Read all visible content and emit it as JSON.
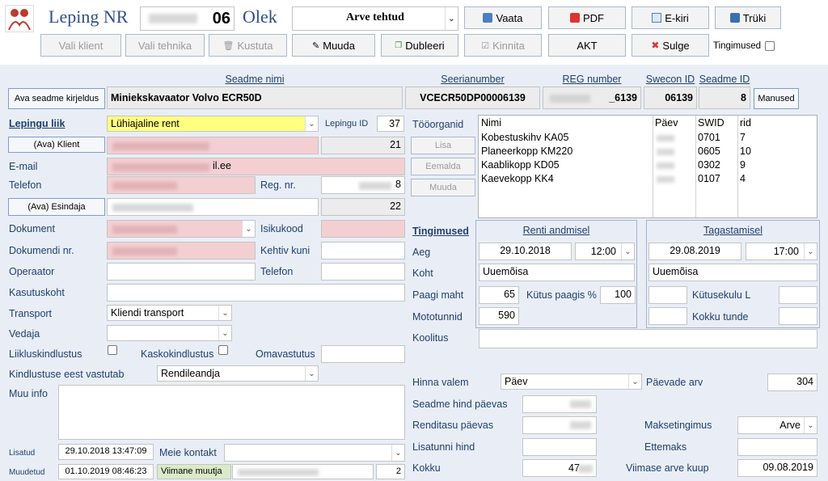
{
  "header": {
    "title": "Leping NR",
    "number": "06",
    "status_label": "Olek",
    "status_value": "Arve tehtud"
  },
  "toolbar": {
    "vaata": "Vaata",
    "pdf": "PDF",
    "ekiri": "E-kiri",
    "truki": "Trüki",
    "vali_klient": "Vali klient",
    "vali_tehnika": "Vali tehnika",
    "kustuta": "Kustuta",
    "muuda": "Muuda",
    "dubleeri": "Dubleeri",
    "kinnita": "Kinnita",
    "akt": "AKT",
    "sulge": "Sulge",
    "tingimused": "Tingimused"
  },
  "device": {
    "open_desc_button": "Ava seadme kirjeldus",
    "name_label": "Seadme nimi",
    "name": "Miniekskavaator Volvo ECR50D",
    "serial_label": "Seerianumber",
    "serial": "VCECR50DP00006139",
    "reg_label": "REG number",
    "reg": "_6139",
    "swecon_label": "Swecon ID",
    "swecon": "06139",
    "seadme_id_label": "Seadme ID",
    "seadme_id": "8",
    "attachments_button": "Manused"
  },
  "contract": {
    "type_label": "Lepingu liik",
    "type_value": "Lühiajaline rent",
    "id_label": "Lepingu ID",
    "id_value": "37",
    "client_button": "(Ava) Klient",
    "client_number": "21",
    "email_label": "E-mail",
    "email_value": "il.ee",
    "phone_label": "Telefon",
    "regnr_label": "Reg. nr.",
    "regnr_value": "8",
    "rep_button": "(Ava) Esindaja",
    "rep_number": "22",
    "doc_label": "Dokument",
    "idcode_label": "Isikukood",
    "docnr_label": "Dokumendi nr.",
    "valid_label": "Kehtiv kuni",
    "operator_label": "Operaator",
    "operator_phone_label": "Telefon",
    "site_label": "Kasutuskoht",
    "transport_label": "Transport",
    "transport_value": "Kliendi transport",
    "carrier_label": "Vedaja",
    "traffic_ins_label": "Liikluskindlustus",
    "casco_ins_label": "Kaskokindlustus",
    "deductible_label": "Omavastutus",
    "ins_resp_label": "Kindlustuse eest vastutab",
    "ins_resp_value": "Rendileandja",
    "other_info_label": "Muu info",
    "added_label": "Lisatud",
    "added_value": "29.10.2018 13:47:09",
    "contact_label": "Meie kontakt",
    "modified_label": "Muudetud",
    "modified_value": "01.10.2019 08:46:23",
    "last_changer_label": "Viimane muutja",
    "last_changer_count": "2"
  },
  "attachments": {
    "label": "Tööorganid",
    "add": "Lisa",
    "remove": "Eemalda",
    "edit": "Muuda",
    "columns": [
      "Nimi",
      "Päev",
      "SWID",
      "rid"
    ],
    "rows": [
      {
        "name": "Kobestuskihv KA05",
        "swid": "0701",
        "rid": "7"
      },
      {
        "name": "Planeerkopp KM220",
        "swid": "0605",
        "rid": "10"
      },
      {
        "name": "Kaablikopp KD05",
        "swid": "0302",
        "rid": "9"
      },
      {
        "name": "Kaevekopp KK4",
        "swid": "0107",
        "rid": "4"
      }
    ]
  },
  "terms": {
    "label": "Tingimused",
    "handover_label": "Renti andmisel",
    "return_label": "Tagastamisel",
    "time_label": "Aeg",
    "handover_date": "29.10.2018",
    "handover_time": "12:00",
    "return_date": "29.08.2019",
    "return_time": "17:00",
    "place_label": "Koht",
    "handover_place": "Uuemõisa",
    "return_place": "Uuemõisa",
    "tank_label": "Paagi maht",
    "tank_value": "65",
    "fuel_label": "Kütus paagis %",
    "fuel_value": "100",
    "fuel_use_label": "Kütusekulu L",
    "engine_label": "Mototunnid",
    "engine_value": "590",
    "total_hours_label": "Kokku tunde",
    "training_label": "Koolitus"
  },
  "pricing": {
    "formula_label": "Hinna valem",
    "formula_value": "Päev",
    "days_label": "Päevade arv",
    "days_value": "304",
    "device_price_label": "Seadme hind päevas",
    "rent_fee_label": "Renditasu päevas",
    "payment_label": "Maksetingimus",
    "payment_value": "Arve",
    "extra_hour_label": "Lisatunni hind",
    "prepay_label": "Ettemaks",
    "total_label": "Kokku",
    "total_value": "47",
    "last_invoice_label": "Viimase arve kuup",
    "last_invoice_value": "09.08.2019"
  },
  "colors": {
    "label": "#1f3f6e",
    "background": "#e9eef6",
    "pink_field": "#f4cfd2",
    "highlight": "#ffff80"
  }
}
